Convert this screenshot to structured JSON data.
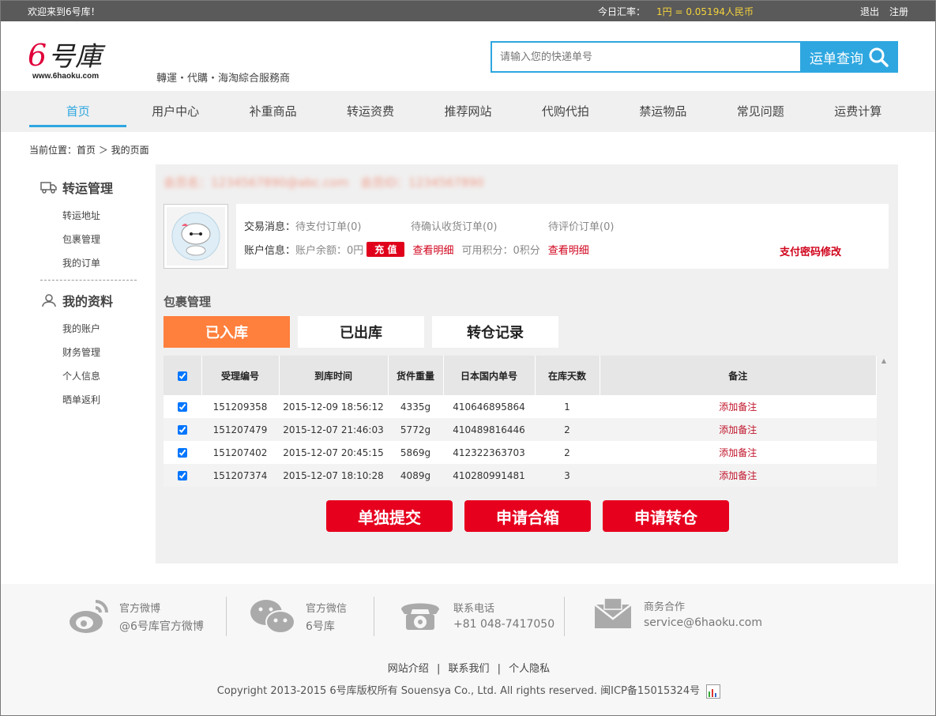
{
  "topbar": {
    "welcome": "欢迎来到6号库！",
    "rate_label": "今日汇率：",
    "rate_value": "1円 = 0.05194人民币",
    "logout": "退出",
    "register": "注册"
  },
  "header": {
    "logo_text": "6号庫",
    "logo_url_text": "www.6haoku.com",
    "slogan": "轉運・代購・海淘綜合服務商",
    "search_placeholder": "请输入您的快递单号",
    "search_button": "运单查询"
  },
  "nav": [
    {
      "label": "首页"
    },
    {
      "label": "用户中心"
    },
    {
      "label": "补重商品"
    },
    {
      "label": "转运资费"
    },
    {
      "label": "推荐网站"
    },
    {
      "label": "代购代拍"
    },
    {
      "label": "禁运物品"
    },
    {
      "label": "常见问题"
    },
    {
      "label": "运费计算"
    }
  ],
  "breadcrumb": "当前位置：首页 ＞ 我的页面",
  "sidebar": {
    "group1": {
      "title": "转运管理",
      "items": [
        {
          "label": "转运地址"
        },
        {
          "label": "包裹管理"
        },
        {
          "label": "我的订单"
        }
      ]
    },
    "group2": {
      "title": "我的资料",
      "items": [
        {
          "label": "我的账户"
        },
        {
          "label": "财务管理"
        },
        {
          "label": "个人信息"
        },
        {
          "label": "晒单返利"
        }
      ]
    }
  },
  "user": {
    "masked_line": "会员名：1234567890@abc.com　会员ID：1234567890"
  },
  "info": {
    "trade_label": "交易消息：",
    "pending_pay": "待支付订单(0)",
    "pending_confirm": "待确认收货订单(0)",
    "pending_review": "待评价订单(0)",
    "account_label": "账户信息：",
    "balance": "账户余额：0円",
    "recharge": "充 值",
    "detail1": "查看明细",
    "points": "可用积分：0积分",
    "detail2": "查看明细",
    "pay_pwd": "支付密码修改"
  },
  "packages": {
    "title": "包裹管理",
    "tabs": [
      {
        "label": "已入库"
      },
      {
        "label": "已出库"
      },
      {
        "label": "转仓记录"
      }
    ],
    "columns": [
      "受理编号",
      "到库时间",
      "货件重量",
      "日本国内单号",
      "在库天数",
      "备注"
    ],
    "rows": [
      {
        "id": "151209358",
        "time": "2015-12-09 18:56:12",
        "weight": "4335g",
        "jp_no": "410646895864",
        "days": "1",
        "note": "添加备注"
      },
      {
        "id": "151207479",
        "time": "2015-12-07 21:46:03",
        "weight": "5772g",
        "jp_no": "410489816446",
        "days": "2",
        "note": "添加备注"
      },
      {
        "id": "151207402",
        "time": "2015-12-07 20:45:15",
        "weight": "5869g",
        "jp_no": "412322363703",
        "days": "2",
        "note": "添加备注"
      },
      {
        "id": "151207374",
        "time": "2015-12-07 18:10:28",
        "weight": "4089g",
        "jp_no": "410280991481",
        "days": "3",
        "note": "添加备注"
      }
    ],
    "actions": [
      {
        "label": "单独提交"
      },
      {
        "label": "申请合箱"
      },
      {
        "label": "申请转仓"
      }
    ]
  },
  "footer": {
    "weibo": {
      "t1": "官方微博",
      "t2": "@6号库官方微博"
    },
    "wechat": {
      "t1": "官方微信",
      "t2": "6号库"
    },
    "phone": {
      "t1": "联系电话",
      "t2": "+81 048-7417050"
    },
    "biz": {
      "t1": "商务合作",
      "t2": "service@6haoku.com"
    },
    "links": [
      "网站介绍",
      "联系我们",
      "个人隐私"
    ],
    "copyright": "Copyright 2013-2015 6号库版权所有 Souensya Co., Ltd. All rights reserved. 闽ICP备15015324号"
  },
  "colors": {
    "accent": "#2ea7e0",
    "orange": "#ff7f3c",
    "red": "#e6001e",
    "rate": "#f5d23c"
  }
}
